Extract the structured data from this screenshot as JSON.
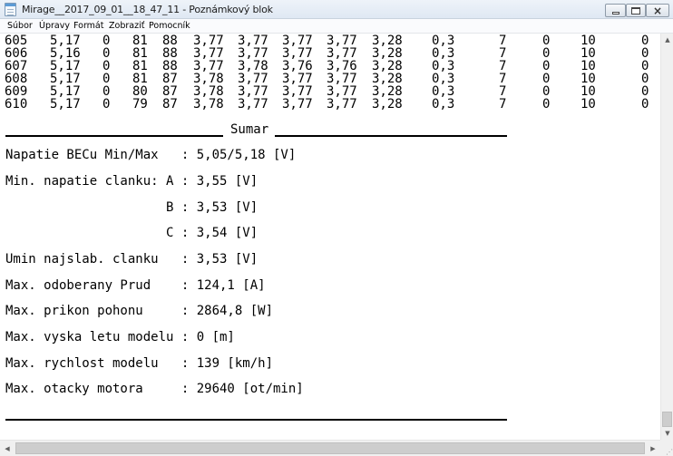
{
  "window": {
    "title": "Mirage__2017_09_01__18_47_11 - Poznámkový blok",
    "app_icon": "notepad-icon",
    "controls": {
      "minimize": "minimize-icon",
      "maximize": "maximize-icon",
      "close": "close-icon"
    }
  },
  "menubar": {
    "items": [
      {
        "label": "Súbor"
      },
      {
        "label": "Úpravy"
      },
      {
        "label": "Formát"
      },
      {
        "label": "Zobraziť"
      },
      {
        "label": "Pomocník"
      }
    ]
  },
  "data_rows": [
    [
      "605",
      "5,17",
      "0",
      "81",
      "88",
      "3,77",
      "3,77",
      "3,77",
      "3,77",
      "3,28",
      "0,3",
      "7",
      "0",
      "10",
      "0"
    ],
    [
      "606",
      "5,16",
      "0",
      "81",
      "88",
      "3,77",
      "3,77",
      "3,77",
      "3,77",
      "3,28",
      "0,3",
      "7",
      "0",
      "10",
      "0"
    ],
    [
      "607",
      "5,17",
      "0",
      "81",
      "88",
      "3,77",
      "3,78",
      "3,76",
      "3,76",
      "3,28",
      "0,3",
      "7",
      "0",
      "10",
      "0"
    ],
    [
      "608",
      "5,17",
      "0",
      "81",
      "87",
      "3,78",
      "3,77",
      "3,77",
      "3,77",
      "3,28",
      "0,3",
      "7",
      "0",
      "10",
      "0"
    ],
    [
      "609",
      "5,17",
      "0",
      "80",
      "87",
      "3,78",
      "3,77",
      "3,77",
      "3,77",
      "3,28",
      "0,3",
      "7",
      "0",
      "10",
      "0"
    ],
    [
      "610",
      "5,17",
      "0",
      "79",
      "87",
      "3,78",
      "3,77",
      "3,77",
      "3,77",
      "3,28",
      "0,3",
      "7",
      "0",
      "10",
      "0"
    ]
  ],
  "summary": {
    "heading": "Sumar",
    "lines": [
      "Napatie BECu Min/Max   : 5,05/5,18 [V]",
      "Min. napatie clanku: A : 3,55 [V]",
      "                     B : 3,53 [V]",
      "                     C : 3,54 [V]",
      "Umin najslab. clanku   : 3,53 [V]",
      "Max. odoberany Prud    : 124,1 [A]",
      "Max. prikon pohonu     : 2864,8 [W]",
      "Max. vyska letu modelu : 0 [m]",
      "Max. rychlost modelu   : 139 [km/h]",
      "Max. otacky motora     : 29640 [ot/min]"
    ]
  },
  "scrollbars": {
    "vertical": {
      "up": "arrow-up-icon",
      "down": "arrow-down-icon"
    },
    "horizontal": {
      "left": "arrow-left-icon",
      "right": "arrow-right-icon"
    }
  }
}
